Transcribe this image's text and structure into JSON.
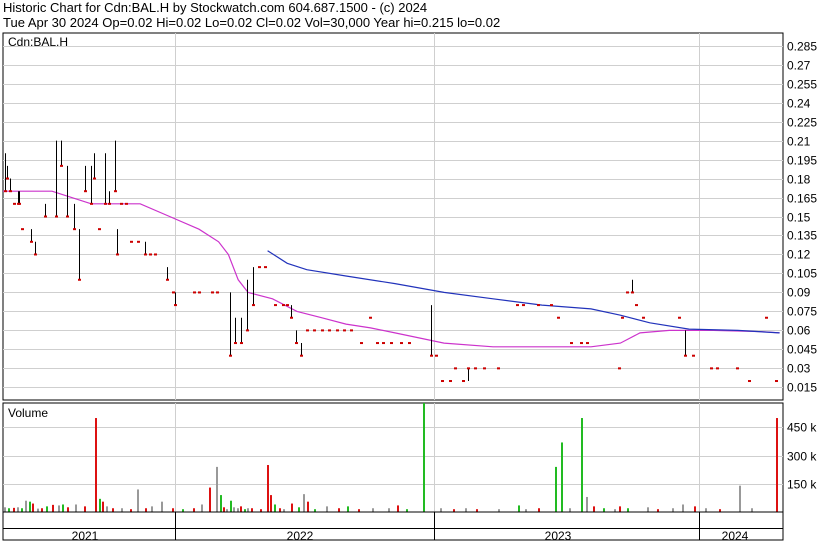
{
  "header": {
    "line1": "Historic Chart for Cdn:BAL.H by Stockwatch.com 604.687.1500 - (c) 2024",
    "line2": "Tue Apr 30 2024  Op=0.02  Hi=0.02  Lo=0.02  Cl=0.02  Vol=30,000  Year hi=0.215  lo=0.02"
  },
  "chart_data": [
    {
      "type": "ohlc",
      "title": "Cdn:BAL.H",
      "ylim": [
        0.005,
        0.295
      ],
      "y_ticks": [
        "0.285",
        "0.27",
        "0.255",
        "0.24",
        "0.225",
        "0.21",
        "0.195",
        "0.18",
        "0.165",
        "0.15",
        "0.135",
        "0.12",
        "0.105",
        "0.09",
        "0.075",
        "0.06",
        "0.045",
        "0.03",
        "0.015"
      ],
      "grid": true,
      "x_labels": [
        "2021",
        "2022",
        "2023",
        "2024"
      ],
      "colors": {
        "grid": "#cfcfcf",
        "bar": "#000000",
        "dot": "#cc0000",
        "ma_short": "#cc33cc",
        "ma_long": "#2233bb"
      },
      "price_bars": [
        [
          0.05,
          0.2,
          0.17
        ],
        [
          0.09,
          0.19,
          0.18
        ],
        [
          0.15,
          0.18,
          0.17
        ],
        [
          0.22,
          0.16,
          0.16
        ],
        [
          0.31,
          0.17,
          0.16
        ],
        [
          0.33,
          0.17,
          0.16
        ],
        [
          0.39,
          0.14,
          0.14
        ],
        [
          0.57,
          0.14,
          0.13
        ],
        [
          0.66,
          0.13,
          0.12
        ],
        [
          0.86,
          0.16,
          0.15
        ],
        [
          1.09,
          0.21,
          0.15
        ],
        [
          1.18,
          0.21,
          0.19
        ],
        [
          1.3,
          0.19,
          0.15
        ],
        [
          1.44,
          0.16,
          0.14
        ],
        [
          1.55,
          0.14,
          0.1
        ],
        [
          1.67,
          0.19,
          0.17
        ],
        [
          1.79,
          0.19,
          0.16
        ],
        [
          1.86,
          0.2,
          0.18
        ],
        [
          1.95,
          0.14,
          0.14
        ],
        [
          2.08,
          0.2,
          0.16
        ],
        [
          2.16,
          0.17,
          0.16
        ],
        [
          2.28,
          0.21,
          0.17
        ],
        [
          2.33,
          0.14,
          0.12
        ],
        [
          2.4,
          0.16,
          0.16
        ],
        [
          2.51,
          0.16,
          0.16
        ],
        [
          2.62,
          0.13,
          0.13
        ],
        [
          2.76,
          0.13,
          0.13
        ],
        [
          2.89,
          0.13,
          0.12
        ],
        [
          3.01,
          0.12,
          0.12
        ],
        [
          3.1,
          0.12,
          0.12
        ],
        [
          3.35,
          0.11,
          0.1
        ],
        [
          3.46,
          0.09,
          0.09
        ],
        [
          3.52,
          0.09,
          0.08
        ],
        [
          3.89,
          0.09,
          0.09
        ],
        [
          3.99,
          0.09,
          0.09
        ],
        [
          4.27,
          0.09,
          0.09
        ],
        [
          4.36,
          0.09,
          0.09
        ],
        [
          4.63,
          0.09,
          0.04
        ],
        [
          4.74,
          0.07,
          0.05
        ],
        [
          4.85,
          0.07,
          0.05
        ],
        [
          4.97,
          0.1,
          0.06
        ],
        [
          5.1,
          0.11,
          0.08
        ],
        [
          5.22,
          0.11,
          0.11
        ],
        [
          5.35,
          0.11,
          0.11
        ],
        [
          5.56,
          0.08,
          0.08
        ],
        [
          5.71,
          0.08,
          0.08
        ],
        [
          5.79,
          0.08,
          0.08
        ],
        [
          5.88,
          0.08,
          0.07
        ],
        [
          5.97,
          0.06,
          0.05
        ],
        [
          6.08,
          0.05,
          0.04
        ],
        [
          6.2,
          0.06,
          0.06
        ],
        [
          6.35,
          0.06,
          0.06
        ],
        [
          6.5,
          0.06,
          0.06
        ],
        [
          6.66,
          0.06,
          0.06
        ],
        [
          6.82,
          0.06,
          0.06
        ],
        [
          6.96,
          0.06,
          0.06
        ],
        [
          7.1,
          0.06,
          0.06
        ],
        [
          7.3,
          0.05,
          0.05
        ],
        [
          7.49,
          0.07,
          0.07
        ],
        [
          7.63,
          0.05,
          0.05
        ],
        [
          7.76,
          0.05,
          0.05
        ],
        [
          7.92,
          0.05,
          0.05
        ],
        [
          8.13,
          0.05,
          0.05
        ],
        [
          8.29,
          0.05,
          0.05
        ],
        [
          8.74,
          0.08,
          0.04
        ],
        [
          8.83,
          0.04,
          0.04
        ],
        [
          8.96,
          0.02,
          0.02
        ],
        [
          9.12,
          0.02,
          0.02
        ],
        [
          9.23,
          0.03,
          0.03
        ],
        [
          9.39,
          0.02,
          0.02
        ],
        [
          9.49,
          0.02,
          0.03
        ],
        [
          9.64,
          0.03,
          0.03
        ],
        [
          9.81,
          0.03,
          0.03
        ],
        [
          10.1,
          0.03,
          0.03
        ],
        [
          10.48,
          0.08,
          0.08
        ],
        [
          10.62,
          0.08,
          0.08
        ],
        [
          10.91,
          0.08,
          0.08
        ],
        [
          11.19,
          0.08,
          0.08
        ],
        [
          11.33,
          0.07,
          0.07
        ],
        [
          11.6,
          0.05,
          0.05
        ],
        [
          11.8,
          0.05,
          0.05
        ],
        [
          11.91,
          0.05,
          0.05
        ],
        [
          12.57,
          0.03,
          0.03
        ],
        [
          12.64,
          0.07,
          0.07
        ],
        [
          12.73,
          0.09,
          0.09
        ],
        [
          12.83,
          0.1,
          0.09
        ],
        [
          12.92,
          0.08,
          0.08
        ],
        [
          13.07,
          0.07,
          0.07
        ],
        [
          13.8,
          0.07,
          0.07
        ],
        [
          13.91,
          0.06,
          0.04
        ],
        [
          14.08,
          0.04,
          0.04
        ],
        [
          14.44,
          0.03,
          0.03
        ],
        [
          14.57,
          0.03,
          0.03
        ],
        [
          14.97,
          0.03,
          0.03
        ],
        [
          15.22,
          0.02,
          0.02
        ],
        [
          15.57,
          0.07,
          0.07
        ],
        [
          15.78,
          0.02,
          0.02
        ]
      ],
      "moving_average_short": [
        [
          0.0,
          0.17
        ],
        [
          1.0,
          0.17
        ],
        [
          1.8,
          0.16
        ],
        [
          2.8,
          0.16
        ],
        [
          3.4,
          0.15
        ],
        [
          4.0,
          0.14
        ],
        [
          4.4,
          0.13
        ],
        [
          4.6,
          0.12
        ],
        [
          4.8,
          0.1
        ],
        [
          5.0,
          0.09
        ],
        [
          5.5,
          0.085
        ],
        [
          6.0,
          0.075
        ],
        [
          6.5,
          0.07
        ],
        [
          7.0,
          0.065
        ],
        [
          7.5,
          0.062
        ],
        [
          8.0,
          0.058
        ],
        [
          9.0,
          0.05
        ],
        [
          10.0,
          0.047
        ],
        [
          11.0,
          0.047
        ],
        [
          12.0,
          0.047
        ],
        [
          12.6,
          0.05
        ],
        [
          13.0,
          0.058
        ],
        [
          13.6,
          0.06
        ],
        [
          14.5,
          0.06
        ],
        [
          15.5,
          0.059
        ],
        [
          15.85,
          0.058
        ]
      ],
      "moving_average_long": [
        [
          5.4,
          0.123
        ],
        [
          5.8,
          0.113
        ],
        [
          6.2,
          0.108
        ],
        [
          7.0,
          0.103
        ],
        [
          8.0,
          0.097
        ],
        [
          9.0,
          0.09
        ],
        [
          10.0,
          0.085
        ],
        [
          11.0,
          0.08
        ],
        [
          12.0,
          0.077
        ],
        [
          12.6,
          0.072
        ],
        [
          13.2,
          0.066
        ],
        [
          14.0,
          0.061
        ],
        [
          15.0,
          0.06
        ],
        [
          15.85,
          0.058
        ]
      ]
    },
    {
      "type": "bar",
      "title": "Volume",
      "y_ticks": [
        "450 k",
        "300 k",
        "150 k"
      ],
      "ylim": [
        0,
        580
      ],
      "colors": {
        "up": "#22bb22",
        "down": "#dd1111",
        "flat": "#999999"
      },
      "bars": [
        [
          0.03,
          25,
          "flat"
        ],
        [
          0.1,
          20,
          "up"
        ],
        [
          0.2,
          22,
          "down"
        ],
        [
          0.29,
          25,
          "flat"
        ],
        [
          0.36,
          20,
          "up"
        ],
        [
          0.45,
          60,
          "flat"
        ],
        [
          0.53,
          55,
          "up"
        ],
        [
          0.6,
          45,
          "down"
        ],
        [
          0.7,
          18,
          "flat"
        ],
        [
          0.78,
          20,
          "down"
        ],
        [
          0.88,
          30,
          "up"
        ],
        [
          0.99,
          38,
          "down"
        ],
        [
          1.12,
          35,
          "flat"
        ],
        [
          1.2,
          40,
          "up"
        ],
        [
          1.31,
          25,
          "down"
        ],
        [
          1.46,
          40,
          "flat"
        ],
        [
          1.66,
          30,
          "down"
        ],
        [
          1.88,
          500,
          "down"
        ],
        [
          1.96,
          70,
          "up"
        ],
        [
          2.02,
          55,
          "down"
        ],
        [
          2.11,
          30,
          "flat"
        ],
        [
          2.22,
          20,
          "down"
        ],
        [
          2.4,
          20,
          "flat"
        ],
        [
          2.6,
          15,
          "down"
        ],
        [
          2.74,
          120,
          "flat"
        ],
        [
          2.89,
          20,
          "down"
        ],
        [
          3.03,
          30,
          "flat"
        ],
        [
          3.22,
          55,
          "flat"
        ],
        [
          3.44,
          20,
          "down"
        ],
        [
          3.66,
          15,
          "up"
        ],
        [
          3.88,
          20,
          "down"
        ],
        [
          4.05,
          40,
          "flat"
        ],
        [
          4.21,
          130,
          "down"
        ],
        [
          4.34,
          240,
          "flat"
        ],
        [
          4.42,
          90,
          "up"
        ],
        [
          4.48,
          25,
          "down"
        ],
        [
          4.56,
          15,
          "flat"
        ],
        [
          4.63,
          60,
          "up"
        ],
        [
          4.7,
          25,
          "flat"
        ],
        [
          4.77,
          20,
          "flat"
        ],
        [
          4.84,
          30,
          "down"
        ],
        [
          4.91,
          15,
          "up"
        ],
        [
          4.98,
          20,
          "flat"
        ],
        [
          5.06,
          20,
          "down"
        ],
        [
          5.25,
          15,
          "down"
        ],
        [
          5.38,
          250,
          "down"
        ],
        [
          5.45,
          90,
          "down"
        ],
        [
          5.54,
          40,
          "up"
        ],
        [
          5.63,
          20,
          "down"
        ],
        [
          5.72,
          15,
          "flat"
        ],
        [
          5.87,
          45,
          "down"
        ],
        [
          6.02,
          25,
          "up"
        ],
        [
          6.12,
          95,
          "flat"
        ],
        [
          6.2,
          55,
          "down"
        ],
        [
          6.34,
          15,
          "up"
        ],
        [
          6.6,
          30,
          "flat"
        ],
        [
          6.84,
          20,
          "down"
        ],
        [
          7.02,
          30,
          "up"
        ],
        [
          7.24,
          15,
          "down"
        ],
        [
          7.54,
          20,
          "flat"
        ],
        [
          7.86,
          20,
          "flat"
        ],
        [
          8.04,
          35,
          "down"
        ],
        [
          8.22,
          15,
          "up"
        ],
        [
          8.58,
          580,
          "up"
        ],
        [
          8.92,
          20,
          "flat"
        ],
        [
          9.18,
          15,
          "down"
        ],
        [
          9.42,
          20,
          "flat"
        ],
        [
          9.66,
          15,
          "down"
        ],
        [
          10.1,
          15,
          "flat"
        ],
        [
          10.5,
          35,
          "up"
        ],
        [
          10.66,
          15,
          "flat"
        ],
        [
          10.92,
          20,
          "down"
        ],
        [
          11.26,
          240,
          "up"
        ],
        [
          11.38,
          370,
          "up"
        ],
        [
          11.56,
          20,
          "flat"
        ],
        [
          11.8,
          500,
          "up"
        ],
        [
          11.9,
          80,
          "flat"
        ],
        [
          12.04,
          30,
          "down"
        ],
        [
          12.24,
          20,
          "up"
        ],
        [
          12.46,
          15,
          "flat"
        ],
        [
          12.57,
          30,
          "down"
        ],
        [
          12.73,
          20,
          "up"
        ],
        [
          13.14,
          25,
          "flat"
        ],
        [
          13.34,
          15,
          "down"
        ],
        [
          13.66,
          20,
          "flat"
        ],
        [
          13.86,
          40,
          "flat"
        ],
        [
          14.1,
          30,
          "down"
        ],
        [
          14.32,
          20,
          "flat"
        ],
        [
          14.62,
          15,
          "down"
        ],
        [
          15.02,
          140,
          "flat"
        ],
        [
          15.26,
          20,
          "flat"
        ],
        [
          15.78,
          500,
          "down"
        ]
      ]
    }
  ]
}
